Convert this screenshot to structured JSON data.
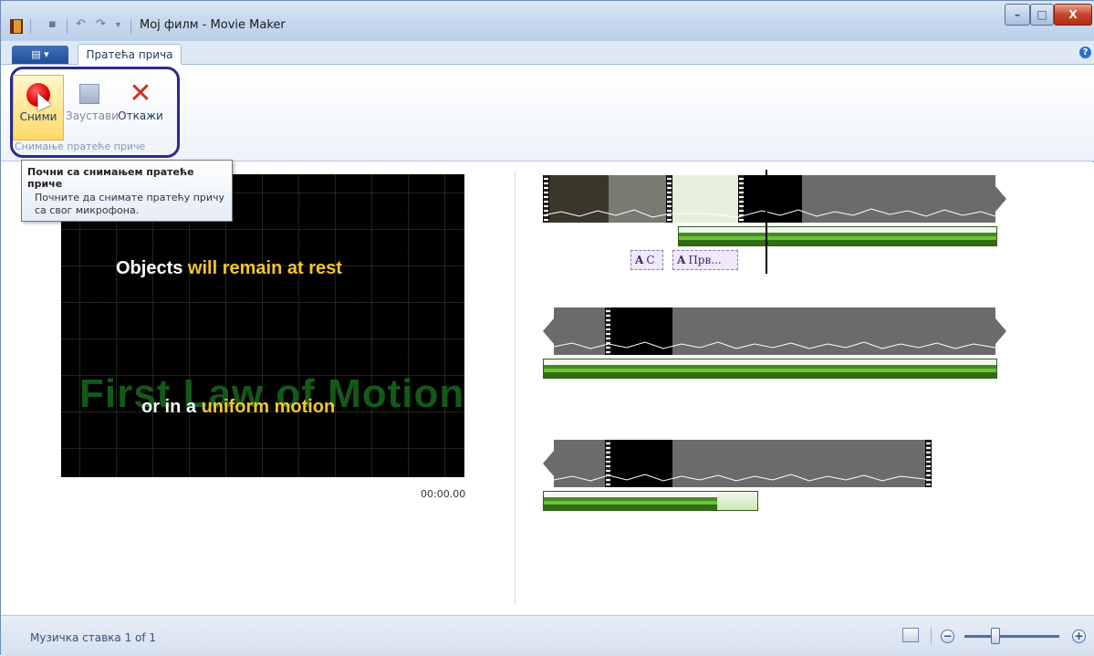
{
  "window": {
    "title": "Мој филм - Movie Maker",
    "controls": {
      "minimize": "–",
      "maximize": "□",
      "close": "X"
    }
  },
  "quick_access": {
    "save_icon": "save-icon",
    "undo_icon": "undo-icon",
    "redo_icon": "redo-icon",
    "customize_icon": "dropdown-icon"
  },
  "tabs": {
    "app_menu_label": "▤ ▾",
    "active_tab": "Пратећа прича",
    "help": "?"
  },
  "ribbon": {
    "record_label": "Сними",
    "stop_label": "Заустави",
    "cancel_label": "Откажи",
    "group_label": "Снимање пратеће приче"
  },
  "tooltip": {
    "title": "Почни са снимањем пратеће приче",
    "body": "Почните да снимате пратећу причу са свог микрофона."
  },
  "preview": {
    "line1_white": "Objects ",
    "line1_yellow": "will remain at rest",
    "background_text": "First Law of Motion",
    "line2_white": "or in a ",
    "line2_yellow": "uniform motion",
    "timecode": "00:00.00"
  },
  "storyboard": {
    "captions": [
      {
        "glyph": "A",
        "text": "C"
      },
      {
        "glyph": "A",
        "text": "Прв..."
      }
    ]
  },
  "statusbar": {
    "text": "Музичка ставка 1 of 1",
    "zoom_out": "−",
    "zoom_in": "+",
    "zoom_level": 0.33
  }
}
